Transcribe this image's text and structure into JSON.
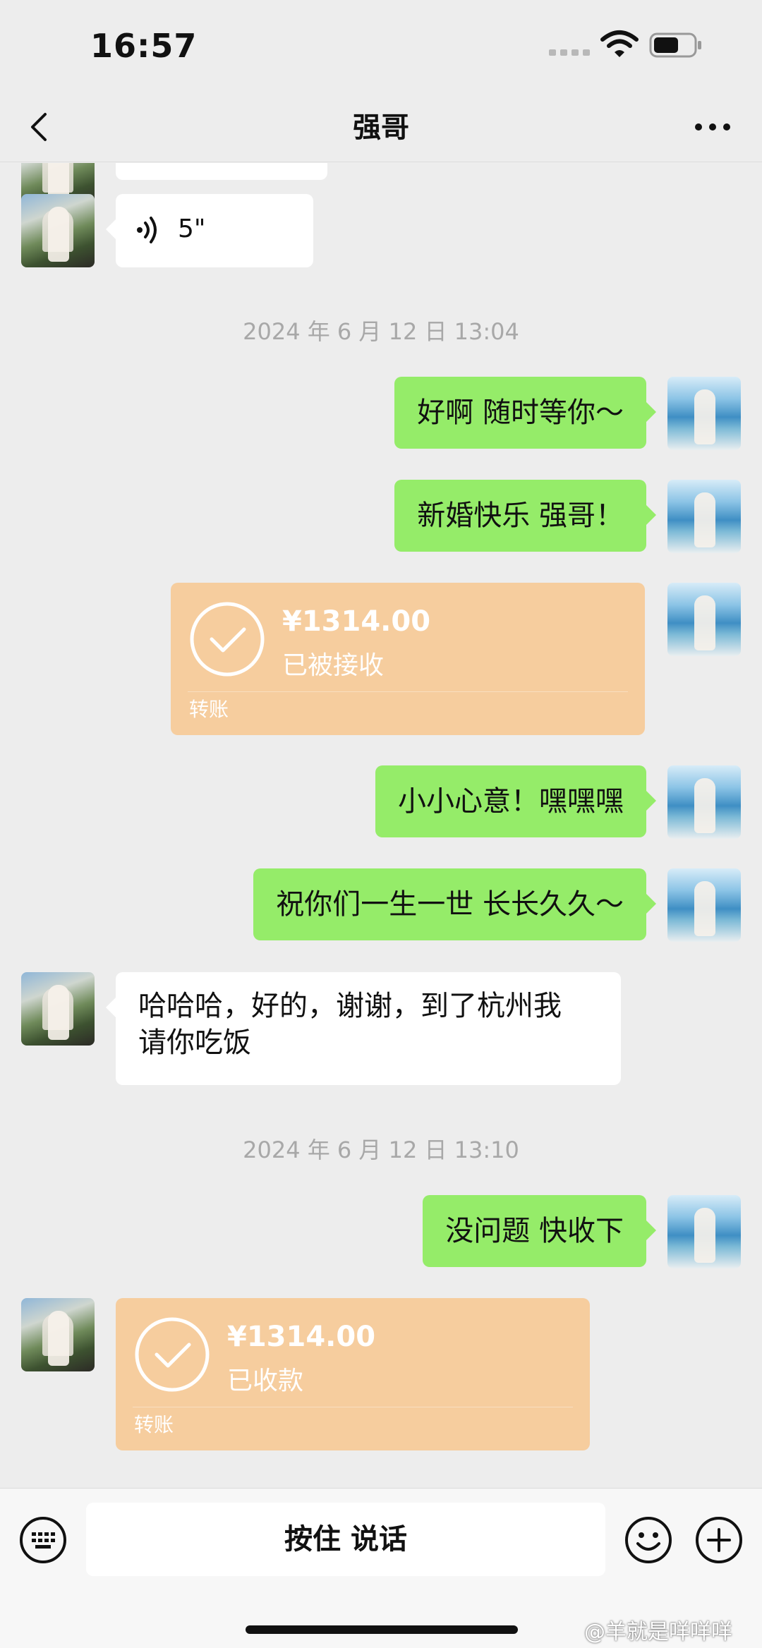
{
  "status_bar": {
    "time": "16:57"
  },
  "nav": {
    "title": "强哥"
  },
  "messages": {
    "voice": {
      "duration": "5\""
    },
    "timestamp_1": "2024 年 6 月 12 日 13:04",
    "m1": "好啊 随时等你～",
    "m2": "新婚快乐 强哥！",
    "transfer_1": {
      "amount": "¥1314.00",
      "status": "已被接收",
      "label": "转账"
    },
    "m3": "小小心意！嘿嘿嘿",
    "m4": "祝你们一生一世 长长久久～",
    "m5_line1": "哈哈哈，好的，谢谢，到了杭州我",
    "m5_line2": "请你吃饭",
    "timestamp_2": "2024 年 6 月 12 日 13:10",
    "m6": "没问题 快收下",
    "transfer_2": {
      "amount": "¥1314.00",
      "status": "已收款",
      "label": "转账"
    }
  },
  "input_bar": {
    "hold_to_talk": "按住 说话"
  },
  "watermark": "@羊就是咩咩咩",
  "colors": {
    "background": "#ededed",
    "sent_bubble": "#95ec69",
    "received_bubble": "#ffffff",
    "transfer_card": "#f6cd9e",
    "timestamp": "#a8a8a8"
  },
  "icons": [
    "back-icon",
    "more-icon",
    "voice-icon",
    "check-icon",
    "keyboard-icon",
    "emoji-icon",
    "plus-icon",
    "wifi-icon",
    "battery-icon",
    "signal-icon"
  ]
}
